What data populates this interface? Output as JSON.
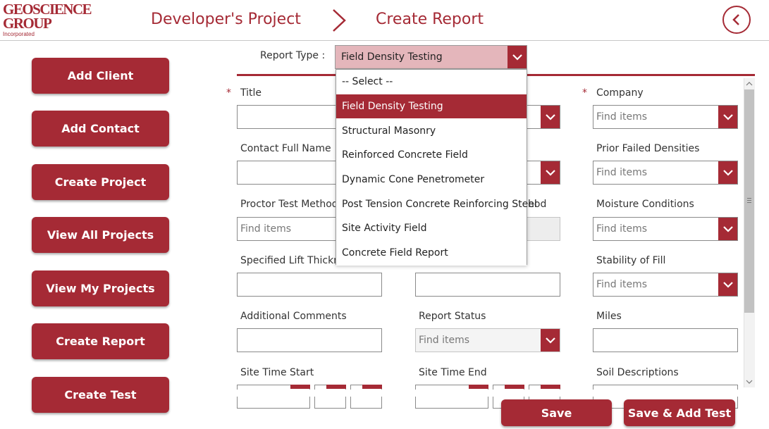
{
  "logo": {
    "line1": "GEOSCIENCE",
    "line2": "GROUP",
    "line3": "Incorporated"
  },
  "header": {
    "breadcrumb_parent": "Developer's Project",
    "breadcrumb_current": "Create Report"
  },
  "nav": [
    "Add Client",
    "Add Contact",
    "Create Project",
    "View All Projects",
    "View My Projects",
    "Create Report",
    "Create Test"
  ],
  "report_type": {
    "label": "Report Type :",
    "selected": "Field Density Testing",
    "options": [
      "-- Select --",
      "Field Density Testing",
      "Structural Masonry",
      "Reinforced Concrete Field",
      "Dynamic Cone Penetrometer",
      "Post Tension Concrete Reinforcing Steel",
      "Site Activity Field",
      "Concrete Field Report"
    ]
  },
  "form": {
    "required_mark": "*",
    "title": "Title",
    "company": "Company",
    "contact_full_name": "Contact Full Name",
    "prior_failed_densities": "Prior Failed Densities",
    "proctor_test_methods": "Proctor Test Methods",
    "method_tail": "hod",
    "moisture_conditions": "Moisture Conditions",
    "specified_lift_thickness": "Specified Lift Thickness",
    "stability_of_fill": "Stability of Fill",
    "additional_comments": "Additional Comments",
    "report_status": "Report Status",
    "miles": "Miles",
    "site_time_start": "Site Time Start",
    "site_time_end": "Site Time End",
    "soil_descriptions": "Soil Descriptions",
    "placeholder": "Find items"
  },
  "actions": {
    "save": "Save",
    "save_add_test": "Save & Add Test"
  },
  "colors": {
    "accent": "#a52a35",
    "selected_bg": "#e4b6bb"
  },
  "icons": {
    "back": "chevron-left-circle-icon",
    "breadcrumb_sep": "chevron-right-icon",
    "dropdown": "chevron-down-icon"
  }
}
